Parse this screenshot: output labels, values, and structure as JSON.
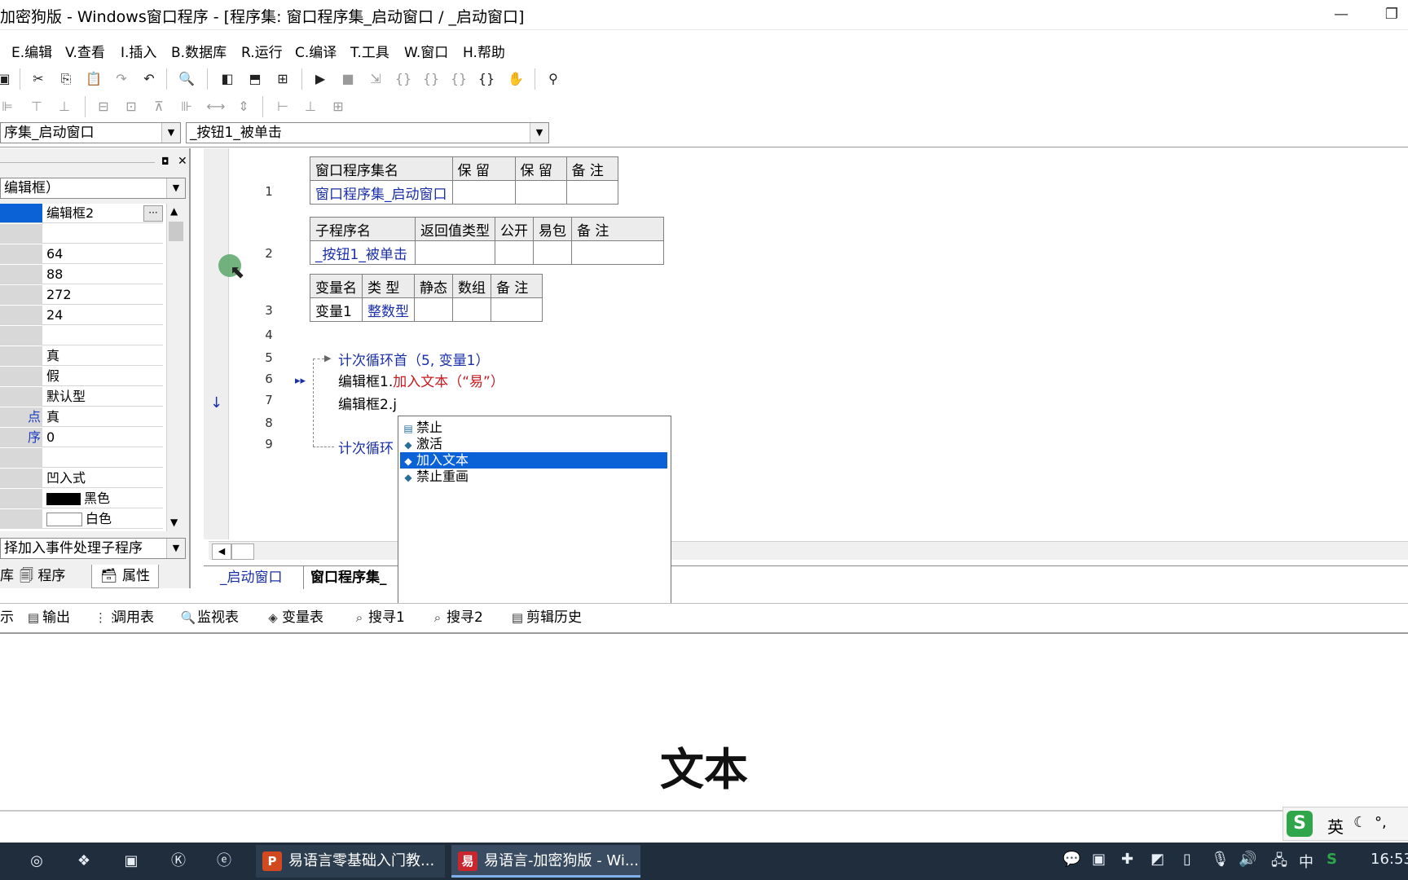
{
  "window": {
    "title": "加密狗版 - Windows窗口程序 - [程序集: 窗口程序集_启动窗口 / _启动窗口]",
    "minimize": "—",
    "restore": "❐"
  },
  "menu": [
    "E.编辑",
    "V.查看",
    "I.插入",
    "B.数据库",
    "R.运行",
    "C.编译",
    "T.工具",
    "W.窗口",
    "H.帮助"
  ],
  "combos": {
    "left": "序集_启动窗口",
    "right": "_按钮1_被单击"
  },
  "left_panel": {
    "object_combo": "编辑框）",
    "properties": [
      {
        "label": "",
        "value": "编辑框2"
      },
      {
        "label": "",
        "value": ""
      },
      {
        "label": "",
        "value": "64"
      },
      {
        "label": "",
        "value": "88"
      },
      {
        "label": "",
        "value": "272"
      },
      {
        "label": "",
        "value": "24"
      },
      {
        "label": "",
        "value": ""
      },
      {
        "label": "",
        "value": "真"
      },
      {
        "label": "",
        "value": "假"
      },
      {
        "label": "",
        "value": "默认型"
      },
      {
        "label": "点",
        "value": "真"
      },
      {
        "label": "序",
        "value": "0"
      },
      {
        "label": "",
        "value": ""
      },
      {
        "label": "",
        "value": "凹入式"
      },
      {
        "label": "",
        "value": "黑色"
      },
      {
        "label": "",
        "value": "白色"
      }
    ],
    "event_combo": "择加入事件处理子程序",
    "tabs": [
      "库",
      "程序",
      "属性"
    ]
  },
  "editor": {
    "line_numbers": [
      "1",
      "2",
      "3",
      "4",
      "5",
      "6",
      "7",
      "8",
      "9"
    ],
    "assembly_table": {
      "headers": [
        "窗口程序集名",
        "保 留",
        "保 留",
        "备 注"
      ],
      "row": [
        "窗口程序集_启动窗口",
        "",
        "",
        ""
      ]
    },
    "sub_table": {
      "headers": [
        "子程序名",
        "返回值类型",
        "公开",
        "易包",
        "备 注"
      ],
      "row": [
        "_按钮1_被单击",
        "",
        "",
        "",
        ""
      ]
    },
    "var_table": {
      "headers": [
        "变量名",
        "类 型",
        "静态",
        "数组",
        "备 注"
      ],
      "row": [
        "变量1",
        "整数型",
        "",
        "",
        ""
      ]
    },
    "line5": "计次循环首（5, 变量1）",
    "line6_obj": "编辑框1.",
    "line6_method": "加入文本",
    "line6_args": "（“易”）",
    "line7": "编辑框2.j",
    "line9": "计次循环"
  },
  "autocomplete": {
    "items": [
      {
        "label": "禁止",
        "selected": false
      },
      {
        "label": "激活",
        "selected": false
      },
      {
        "label": "加入文本",
        "selected": true
      },
      {
        "label": "禁止重画",
        "selected": false
      }
    ]
  },
  "editor_tabs": [
    "_启动窗口",
    "窗口程序集_"
  ],
  "bottom_tabs": [
    "示",
    "输出",
    "调用表",
    "监视表",
    "变量表",
    "搜寻1",
    "搜寻2",
    "剪辑历史"
  ],
  "caption": "文本",
  "ime": {
    "lang": "英"
  },
  "taskbar": {
    "apps": [
      "易语言零基础入门教...",
      "易语言-加密狗版 - Wi..."
    ],
    "tray_lang": "中",
    "time": "16:53"
  },
  "colors": {
    "selection": "#0b61d6",
    "code_blue": "#1a2fa8",
    "code_red": "#c8191f",
    "taskbar": "#1f2d3d"
  }
}
